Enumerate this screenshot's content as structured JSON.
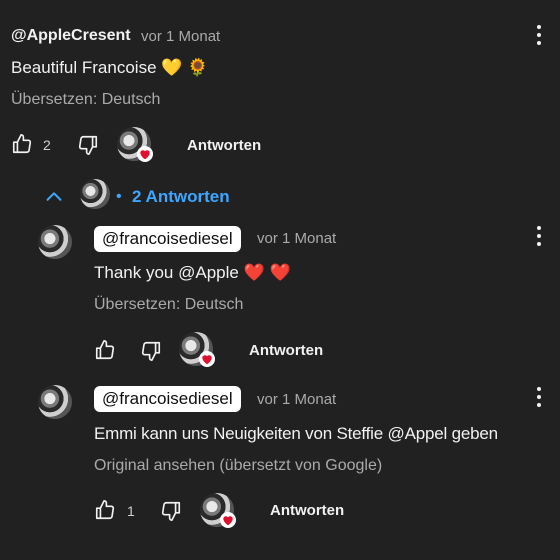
{
  "comment": {
    "author": "@AppleCresent",
    "time": "vor 1 Monat",
    "text": "Beautiful Francoise",
    "emoji": "💛 🌻",
    "translate": "Übersetzen: Deutsch",
    "like_count": "2",
    "reply_label": "Antworten"
  },
  "replies_toggle": {
    "separator": "•",
    "label": "2 Antworten"
  },
  "replies": [
    {
      "author": "@francoisediesel",
      "time": "vor 1 Monat",
      "text": "Thank you @Apple",
      "emoji": "❤️ ❤️",
      "translate": "Übersetzen: Deutsch",
      "like_count": "",
      "reply_label": "Antworten"
    },
    {
      "author": "@francoisediesel",
      "time": "vor 1 Monat",
      "text": "Emmi kann uns Neuigkeiten von Steffie @Appel geben",
      "translate": "Original ansehen (übersetzt von Google)",
      "like_count": "1",
      "reply_label": "Antworten"
    }
  ],
  "colors": {
    "background": "#212121",
    "link_blue": "#3ea6ff",
    "heart": "#e0102f"
  }
}
